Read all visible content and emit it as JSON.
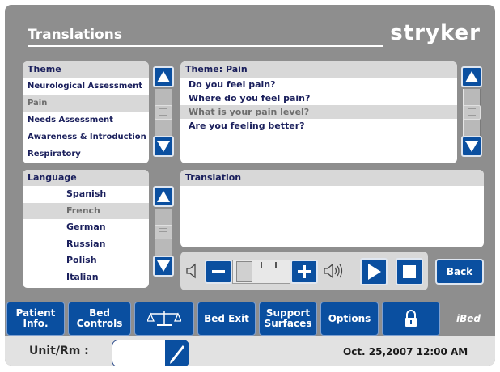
{
  "header": {
    "title": "Translations",
    "logo": "stryker"
  },
  "theme_panel": {
    "heading": "Theme",
    "items": [
      "Neurological Assessment",
      "Pain",
      "Needs Assessment",
      "Awareness & Introduction",
      "Respiratory"
    ],
    "selected": "Pain"
  },
  "question_panel": {
    "heading": "Theme: Pain",
    "items": [
      "Do you feel pain?",
      "Where do you feel pain?",
      "What is your pain level?",
      "Are you feeling better?"
    ],
    "selected": "What is your pain level?"
  },
  "language_panel": {
    "heading": "Language",
    "items": [
      "Spanish",
      "French",
      "German",
      "Russian",
      "Polish",
      "Italian"
    ],
    "selected": "French"
  },
  "translation_panel": {
    "heading": "Translation",
    "text": ""
  },
  "audio": {
    "minus": "−",
    "plus": "+",
    "volume_icon_low": "speaker-low-icon",
    "volume_icon_high": "speaker-high-icon",
    "play_icon": "play-icon",
    "stop_icon": "stop-icon"
  },
  "back_label": "Back",
  "tabs": [
    {
      "label": "Patient Info."
    },
    {
      "label": "Bed Controls"
    },
    {
      "label": "",
      "icon": "scale-icon"
    },
    {
      "label": "Bed Exit"
    },
    {
      "label": "Support Surfaces"
    },
    {
      "label": "Options"
    },
    {
      "label": "",
      "icon": "lock-icon"
    },
    {
      "label": "iBed"
    }
  ],
  "footer": {
    "unit_label": "Unit/Rm :",
    "unit_value": "",
    "datetime": "Oct. 25,2007  12:00 AM"
  },
  "colors": {
    "frame": "#8e8e8e",
    "accent_blue": "#0a4fa0",
    "text_navy": "#1a1f5c",
    "selected_row": "#d8d8d8"
  }
}
